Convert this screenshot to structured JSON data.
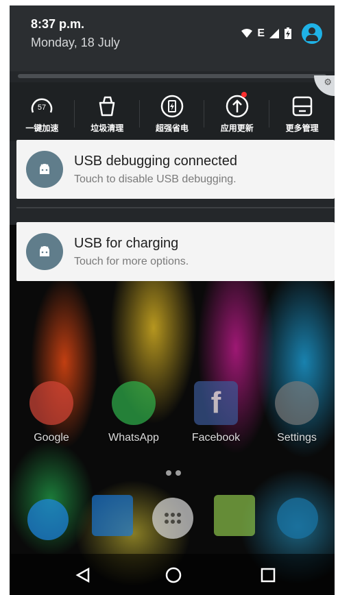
{
  "status_bar": {
    "time": "8:37 p.m.",
    "date": "Monday, 18 July",
    "icons": [
      "wifi-icon",
      "network-e-icon",
      "signal-icon",
      "battery-charging-icon",
      "account-avatar-icon"
    ],
    "network_type": "E"
  },
  "quick_actions": [
    {
      "label": "一键加速",
      "icon": "speed-boost-icon",
      "badge": "57"
    },
    {
      "label": "垃圾清理",
      "icon": "trash-clean-icon"
    },
    {
      "label": "超强省电",
      "icon": "battery-saver-icon"
    },
    {
      "label": "应用更新",
      "icon": "app-update-icon",
      "has_dot": true
    },
    {
      "label": "更多管理",
      "icon": "more-manage-icon"
    }
  ],
  "notifications": [
    {
      "title": "USB debugging connected",
      "text": "Touch to disable USB debugging.",
      "icon": "android-icon"
    },
    {
      "title": "USB for charging",
      "text": "Touch for more options.",
      "icon": "android-icon"
    }
  ],
  "home_apps": [
    {
      "name": "Google",
      "icon": "gmail-icon",
      "color": "#d44638"
    },
    {
      "name": "WhatsApp",
      "icon": "whatsapp-icon",
      "color": "#2fb24b"
    },
    {
      "name": "Facebook",
      "icon": "facebook-icon",
      "color": "#3b5998"
    },
    {
      "name": "Settings",
      "icon": "settings-icon",
      "color": "#777777"
    }
  ],
  "dock": [
    {
      "icon": "phone-icon"
    },
    {
      "icon": "contacts-icon"
    },
    {
      "icon": "app-drawer-icon"
    },
    {
      "icon": "messages-icon"
    },
    {
      "icon": "browser-icon"
    }
  ],
  "nav": [
    "back-icon",
    "home-icon",
    "recents-icon"
  ],
  "colors": {
    "accent": "#1fb2e6",
    "notification_bg": "#f4f4f4",
    "shade_bg": "#24272a"
  }
}
